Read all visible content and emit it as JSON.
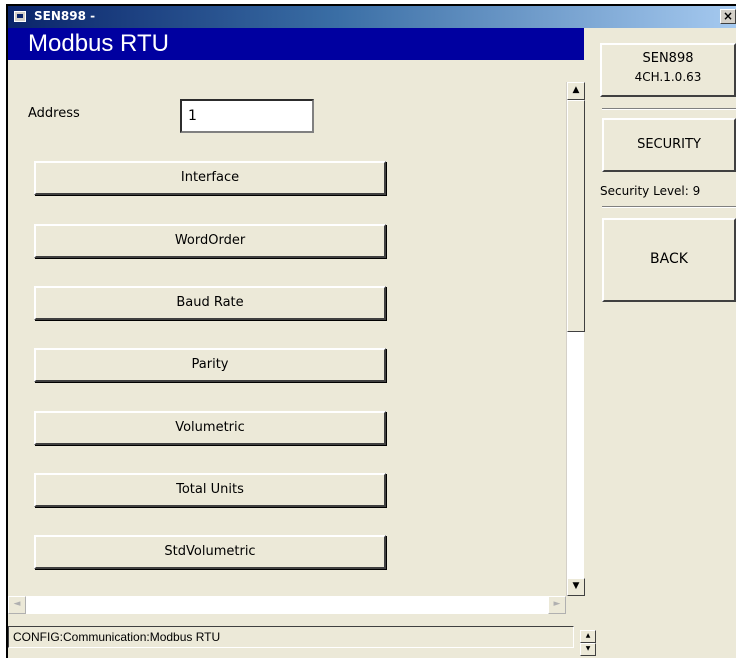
{
  "window": {
    "title": "SEN898 -",
    "close_glyph": "×"
  },
  "panel": {
    "title": "Modbus RTU",
    "address_label": "Address",
    "address_value": "1"
  },
  "menu_buttons": [
    "Interface",
    "WordOrder",
    "Baud Rate",
    "Parity",
    "Volumetric",
    "Total Units",
    "StdVolumetric"
  ],
  "scrollbars": {
    "up_glyph": "▲",
    "down_glyph": "▼",
    "left_glyph": "◄",
    "right_glyph": "►"
  },
  "status_bar": {
    "path": "CONFIG:Communication:Modbus RTU"
  },
  "right_panel": {
    "device_name": "SEN898",
    "version": "4CH.1.0.63",
    "security_button": "SECURITY",
    "security_level": "Security Level: 9",
    "back_button": "BACK"
  },
  "colors": {
    "panel_title_bg": "#0000a0",
    "panel_title_fg": "#ffffff",
    "window_bg": "#ece9d8"
  }
}
